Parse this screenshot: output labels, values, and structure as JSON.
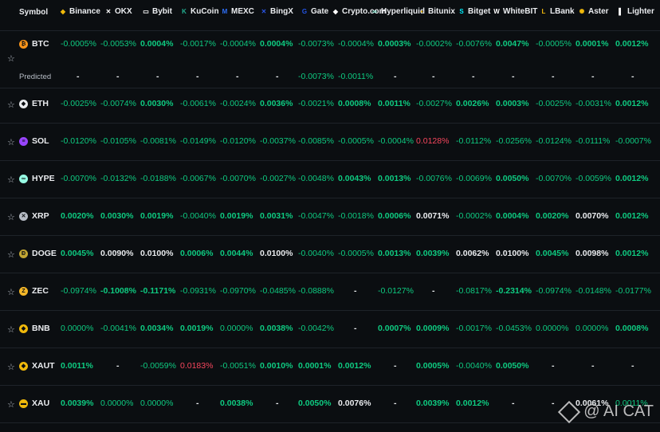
{
  "header": {
    "symbol_label": "Symbol",
    "exchanges": [
      {
        "name": "Binance",
        "icon": "binance-icon",
        "color": "#f0b90b"
      },
      {
        "name": "OKX",
        "icon": "okx-icon",
        "color": "#ffffff"
      },
      {
        "name": "Bybit",
        "icon": "bybit-icon",
        "color": "#ffffff"
      },
      {
        "name": "KuCoin",
        "icon": "kucoin-icon",
        "color": "#23af91"
      },
      {
        "name": "MEXC",
        "icon": "mexc-icon",
        "color": "#2f6ff7"
      },
      {
        "name": "BingX",
        "icon": "bingx-icon",
        "color": "#2a55e5"
      },
      {
        "name": "Gate",
        "icon": "gate-icon",
        "color": "#2354e6"
      },
      {
        "name": "Crypto.com",
        "icon": "cryptocom-icon",
        "color": "#ffffff"
      },
      {
        "name": "Hyperliquid",
        "icon": "hyperliquid-icon",
        "color": "#97fce4"
      },
      {
        "name": "Bitunix",
        "icon": "bitunix-icon",
        "color": "#f0b90b"
      },
      {
        "name": "Bitget",
        "icon": "bitget-icon",
        "color": "#00f0ff"
      },
      {
        "name": "WhiteBIT",
        "icon": "whitebit-icon",
        "color": "#ffffff"
      },
      {
        "name": "LBank",
        "icon": "lbank-icon",
        "color": "#f0b90b"
      },
      {
        "name": "Aster",
        "icon": "aster-icon",
        "color": "#f0b90b"
      },
      {
        "name": "Lighter",
        "icon": "lighter-icon",
        "color": "#ffffff"
      }
    ]
  },
  "predicted_label": "Predicted",
  "rows": [
    {
      "symbol": "BTC",
      "icon": "btc-icon",
      "color": "#f7931a",
      "values": [
        [
          "-0.0005%",
          "g"
        ],
        [
          "-0.0053%",
          "g"
        ],
        [
          "0.0004%",
          "gb"
        ],
        [
          "-0.0017%",
          "g"
        ],
        [
          "-0.0004%",
          "g"
        ],
        [
          "0.0004%",
          "gb"
        ],
        [
          "-0.0073%",
          "g"
        ],
        [
          "-0.0004%",
          "g"
        ],
        [
          "0.0003%",
          "gb"
        ],
        [
          "-0.0002%",
          "g"
        ],
        [
          "-0.0076%",
          "g"
        ],
        [
          "0.0047%",
          "gb"
        ],
        [
          "-0.0005%",
          "g"
        ],
        [
          "0.0001%",
          "gb"
        ],
        [
          "0.0012%",
          "gb"
        ]
      ],
      "predicted": [
        [
          "-",
          "dash"
        ],
        [
          "-",
          "dash"
        ],
        [
          "-",
          "dash"
        ],
        [
          "-",
          "dash"
        ],
        [
          "-",
          "dash"
        ],
        [
          "-",
          "dash"
        ],
        [
          "-0.0073%",
          "g"
        ],
        [
          "-0.0011%",
          "g"
        ],
        [
          "-",
          "dash"
        ],
        [
          "-",
          "dash"
        ],
        [
          "-",
          "dash"
        ],
        [
          "-",
          "dash"
        ],
        [
          "-",
          "dash"
        ],
        [
          "-",
          "dash"
        ],
        [
          "-",
          "dash"
        ]
      ]
    },
    {
      "symbol": "ETH",
      "icon": "eth-icon",
      "color": "#eaecef",
      "values": [
        [
          "-0.0025%",
          "g"
        ],
        [
          "-0.0074%",
          "g"
        ],
        [
          "0.0030%",
          "gb"
        ],
        [
          "-0.0061%",
          "g"
        ],
        [
          "-0.0024%",
          "g"
        ],
        [
          "0.0036%",
          "gb"
        ],
        [
          "-0.0021%",
          "g"
        ],
        [
          "0.0008%",
          "gb"
        ],
        [
          "0.0011%",
          "gb"
        ],
        [
          "-0.0027%",
          "g"
        ],
        [
          "0.0026%",
          "gb"
        ],
        [
          "0.0003%",
          "gb"
        ],
        [
          "-0.0025%",
          "g"
        ],
        [
          "-0.0031%",
          "g"
        ],
        [
          "0.0012%",
          "gb"
        ]
      ]
    },
    {
      "symbol": "SOL",
      "icon": "sol-icon",
      "color": "#9945ff",
      "values": [
        [
          "-0.0120%",
          "g"
        ],
        [
          "-0.0105%",
          "g"
        ],
        [
          "-0.0081%",
          "g"
        ],
        [
          "-0.0149%",
          "g"
        ],
        [
          "-0.0120%",
          "g"
        ],
        [
          "-0.0037%",
          "g"
        ],
        [
          "-0.0085%",
          "g"
        ],
        [
          "-0.0005%",
          "g"
        ],
        [
          "-0.0004%",
          "g"
        ],
        [
          "0.0128%",
          "r"
        ],
        [
          "-0.0112%",
          "g"
        ],
        [
          "-0.0256%",
          "g"
        ],
        [
          "-0.0124%",
          "g"
        ],
        [
          "-0.0111%",
          "g"
        ],
        [
          "-0.0007%",
          "g"
        ]
      ]
    },
    {
      "symbol": "HYPE",
      "icon": "hype-icon",
      "color": "#97fce4",
      "values": [
        [
          "-0.0070%",
          "g"
        ],
        [
          "-0.0132%",
          "g"
        ],
        [
          "-0.0188%",
          "g"
        ],
        [
          "-0.0067%",
          "g"
        ],
        [
          "-0.0070%",
          "g"
        ],
        [
          "-0.0027%",
          "g"
        ],
        [
          "-0.0048%",
          "g"
        ],
        [
          "0.0043%",
          "gb"
        ],
        [
          "0.0013%",
          "gb"
        ],
        [
          "-0.0076%",
          "g"
        ],
        [
          "-0.0069%",
          "g"
        ],
        [
          "0.0050%",
          "gb"
        ],
        [
          "-0.0070%",
          "g"
        ],
        [
          "-0.0059%",
          "g"
        ],
        [
          "0.0012%",
          "gb"
        ]
      ]
    },
    {
      "symbol": "XRP",
      "icon": "xrp-icon",
      "color": "#b7bdc6",
      "values": [
        [
          "0.0020%",
          "gb"
        ],
        [
          "0.0030%",
          "gb"
        ],
        [
          "0.0019%",
          "gb"
        ],
        [
          "-0.0040%",
          "g"
        ],
        [
          "0.0019%",
          "gb"
        ],
        [
          "0.0031%",
          "gb"
        ],
        [
          "-0.0047%",
          "g"
        ],
        [
          "-0.0018%",
          "g"
        ],
        [
          "0.0006%",
          "gb"
        ],
        [
          "0.0071%",
          "w"
        ],
        [
          "-0.0002%",
          "g"
        ],
        [
          "0.0004%",
          "gb"
        ],
        [
          "0.0020%",
          "gb"
        ],
        [
          "0.0070%",
          "w"
        ],
        [
          "0.0012%",
          "gb"
        ]
      ]
    },
    {
      "symbol": "DOGE",
      "icon": "doge-icon",
      "color": "#c2a633",
      "values": [
        [
          "0.0045%",
          "gb"
        ],
        [
          "0.0090%",
          "w"
        ],
        [
          "0.0100%",
          "w"
        ],
        [
          "0.0006%",
          "gb"
        ],
        [
          "0.0044%",
          "gb"
        ],
        [
          "0.0100%",
          "w"
        ],
        [
          "-0.0040%",
          "g"
        ],
        [
          "-0.0005%",
          "g"
        ],
        [
          "0.0013%",
          "gb"
        ],
        [
          "0.0039%",
          "gb"
        ],
        [
          "0.0062%",
          "w"
        ],
        [
          "0.0100%",
          "w"
        ],
        [
          "0.0045%",
          "gb"
        ],
        [
          "0.0098%",
          "w"
        ],
        [
          "0.0012%",
          "gb"
        ]
      ]
    },
    {
      "symbol": "ZEC",
      "icon": "zec-icon",
      "color": "#f4b728",
      "values": [
        [
          "-0.0974%",
          "g"
        ],
        [
          "-0.1008%",
          "gb"
        ],
        [
          "-0.1171%",
          "gb"
        ],
        [
          "-0.0931%",
          "g"
        ],
        [
          "-0.0970%",
          "g"
        ],
        [
          "-0.0485%",
          "g"
        ],
        [
          "-0.0888%",
          "g"
        ],
        [
          "-",
          "dash"
        ],
        [
          "-0.0127%",
          "g"
        ],
        [
          "-",
          "dash"
        ],
        [
          "-0.0817%",
          "g"
        ],
        [
          "-0.2314%",
          "gb"
        ],
        [
          "-0.0974%",
          "g"
        ],
        [
          "-0.0148%",
          "g"
        ],
        [
          "-0.0177%",
          "g"
        ]
      ]
    },
    {
      "symbol": "BNB",
      "icon": "bnb-icon",
      "color": "#f0b90b",
      "values": [
        [
          "0.0000%",
          "g"
        ],
        [
          "-0.0041%",
          "g"
        ],
        [
          "0.0034%",
          "gb"
        ],
        [
          "0.0019%",
          "gb"
        ],
        [
          "0.0000%",
          "g"
        ],
        [
          "0.0038%",
          "gb"
        ],
        [
          "-0.0042%",
          "g"
        ],
        [
          "-",
          "dash"
        ],
        [
          "0.0007%",
          "gb"
        ],
        [
          "0.0009%",
          "gb"
        ],
        [
          "-0.0017%",
          "g"
        ],
        [
          "-0.0453%",
          "g"
        ],
        [
          "0.0000%",
          "g"
        ],
        [
          "0.0000%",
          "g"
        ],
        [
          "0.0008%",
          "gb"
        ]
      ]
    },
    {
      "symbol": "XAUT",
      "icon": "xaut-icon",
      "color": "#f0b90b",
      "values": [
        [
          "0.0011%",
          "gb"
        ],
        [
          "-",
          "dash"
        ],
        [
          "-0.0059%",
          "g"
        ],
        [
          "0.0183%",
          "r"
        ],
        [
          "-0.0051%",
          "g"
        ],
        [
          "0.0010%",
          "gb"
        ],
        [
          "0.0001%",
          "gb"
        ],
        [
          "0.0012%",
          "gb"
        ],
        [
          "-",
          "dash"
        ],
        [
          "0.0005%",
          "gb"
        ],
        [
          "-0.0040%",
          "g"
        ],
        [
          "0.0050%",
          "gb"
        ],
        [
          "-",
          "dash"
        ],
        [
          "-",
          "dash"
        ],
        [
          "-",
          "dash"
        ]
      ]
    },
    {
      "symbol": "XAU",
      "icon": "xau-icon",
      "color": "#f0b90b",
      "values": [
        [
          "0.0039%",
          "gb"
        ],
        [
          "0.0000%",
          "g"
        ],
        [
          "0.0000%",
          "g"
        ],
        [
          "-",
          "dash"
        ],
        [
          "0.0038%",
          "gb"
        ],
        [
          "-",
          "dash"
        ],
        [
          "0.0050%",
          "gb"
        ],
        [
          "0.0076%",
          "w"
        ],
        [
          "-",
          "dash"
        ],
        [
          "0.0039%",
          "gb"
        ],
        [
          "0.0012%",
          "gb"
        ],
        [
          "-",
          "dash"
        ],
        [
          "-",
          "dash"
        ],
        [
          "0.0061%",
          "w"
        ],
        [
          "0.0011%",
          "g"
        ]
      ]
    }
  ],
  "watermark": "@ AI CAT"
}
